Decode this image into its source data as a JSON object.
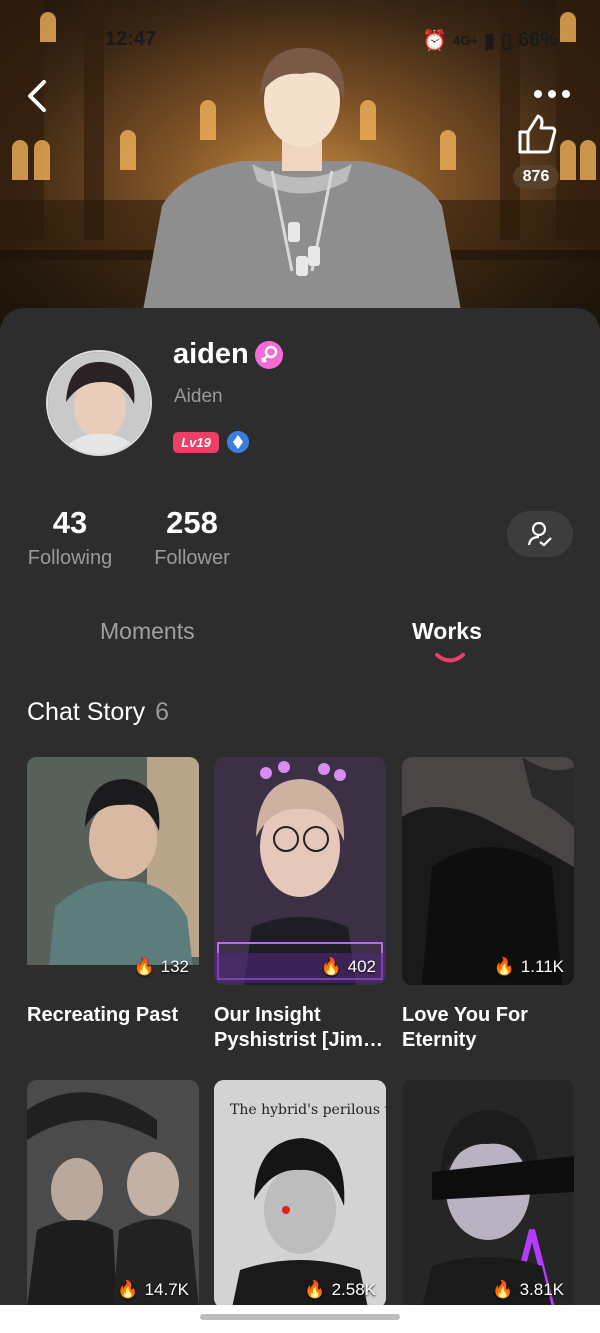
{
  "status_bar": {
    "time": "12:47",
    "battery": "66%",
    "network": "4G+"
  },
  "header": {
    "likes": "876"
  },
  "profile": {
    "username": "aiden",
    "nickname": "Aiden",
    "level": "Lv19",
    "following_count": "43",
    "following_label": "Following",
    "follower_count": "258",
    "follower_label": "Follower"
  },
  "tabs": [
    {
      "label": "Moments",
      "active": false
    },
    {
      "label": "Works",
      "active": true
    }
  ],
  "section": {
    "title": "Chat Story",
    "count": "6"
  },
  "stories": [
    {
      "title": "Recreating Past",
      "heat": "132"
    },
    {
      "title": "Our Insight Pyshistrist [Jim…",
      "heat": "402"
    },
    {
      "title": "Love You For Eternity",
      "heat": "1.11K"
    },
    {
      "title": "",
      "heat": "14.7K"
    },
    {
      "title": "",
      "heat": "2.58K"
    },
    {
      "title": "",
      "heat": "3.81K"
    }
  ],
  "icons": {
    "back": "chevron-left-icon",
    "more": "more-dots-icon",
    "like": "thumbs-up-icon",
    "gender": "female-icon",
    "friend": "user-check-icon",
    "heat": "flame-icon"
  },
  "colors": {
    "accent": "#ec3f66",
    "gender": "#f46bd7",
    "level": "#ec3f66"
  }
}
